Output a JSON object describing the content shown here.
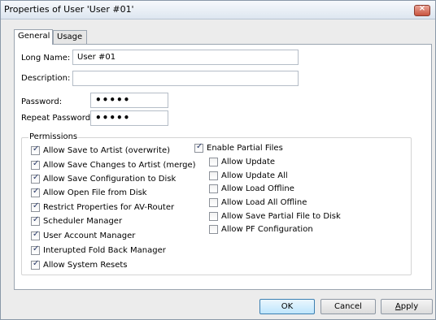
{
  "window": {
    "title": "Properties of User 'User #01'"
  },
  "tabs": [
    {
      "label": "General",
      "active": true
    },
    {
      "label": "Usage",
      "active": false
    }
  ],
  "general": {
    "long_name_label": "Long Name:",
    "long_name_value": "User #01",
    "description_label": "Description:",
    "description_value": "",
    "password_label": "Password:",
    "password_value": "•••••",
    "repeat_password_label": "Repeat Password:",
    "repeat_password_value": "•••••"
  },
  "permissions": {
    "label": "Permissions",
    "left": [
      {
        "label": "Allow Save to Artist (overwrite)",
        "checked": true
      },
      {
        "label": "Allow Save Changes to Artist (merge)",
        "checked": true
      },
      {
        "label": "Allow Save Configuration to Disk",
        "checked": true
      },
      {
        "label": "Allow Open File from Disk",
        "checked": true
      },
      {
        "label": "Restrict Properties for AV-Router",
        "checked": true
      },
      {
        "label": "Scheduler Manager",
        "checked": true
      },
      {
        "label": "User Account Manager",
        "checked": true
      },
      {
        "label": "Interupted Fold Back  Manager",
        "checked": true
      },
      {
        "label": "Allow System Resets",
        "checked": true
      }
    ],
    "partial": {
      "label": "Enable Partial Files",
      "checked": true
    },
    "right": [
      {
        "label": "Allow Update",
        "checked": false
      },
      {
        "label": "Allow Update All",
        "checked": false
      },
      {
        "label": "Allow Load Offline",
        "checked": false
      },
      {
        "label": "Allow Load All Offline",
        "checked": false
      },
      {
        "label": "Allow Save Partial File to Disk",
        "checked": false
      },
      {
        "label": "Allow PF Configuration",
        "checked": false
      }
    ]
  },
  "buttons": {
    "ok": "OK",
    "cancel": "Cancel",
    "apply_mnemonic": "A",
    "apply_rest": "pply"
  },
  "colors": {
    "close_button": "#c9543f",
    "default_button": "#bee6fd"
  }
}
